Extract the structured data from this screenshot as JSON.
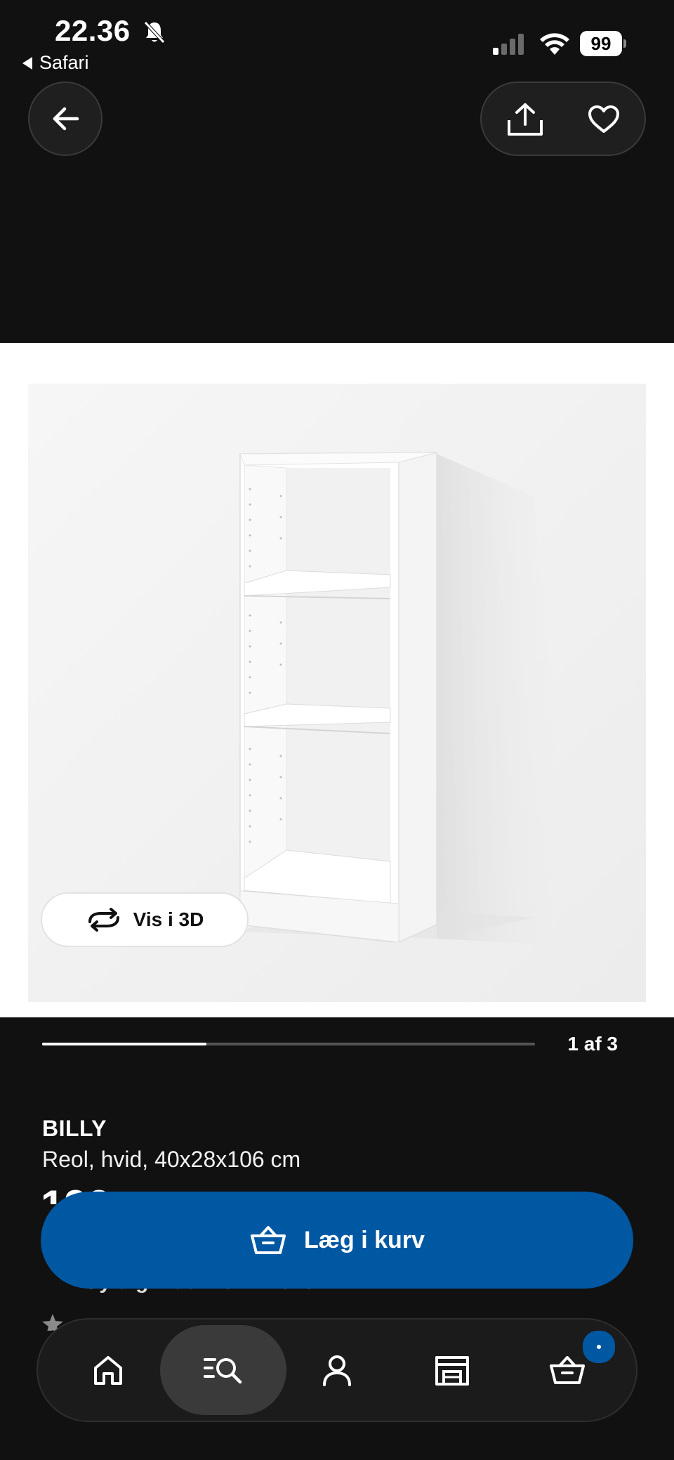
{
  "status_bar": {
    "time": "22.36",
    "back_app": "Safari",
    "battery": "99"
  },
  "header": {
    "back_icon": "arrow-left-icon",
    "share_icon": "share-icon",
    "favorite_icon": "heart-icon"
  },
  "gallery": {
    "view_3d_label": "Vis i 3D",
    "counter": "1 af 3",
    "current_image": 1,
    "total_images": 3
  },
  "product": {
    "name": "BILLY",
    "description": "Reol, hvid, 40x28x106 cm",
    "price_partial": "199",
    "validity_partial": "Gyldig indtil 29.11.2025"
  },
  "cta": {
    "add_to_cart_label": "Læg i kurv",
    "color": "#0058a3"
  },
  "bottom_nav": {
    "items": [
      {
        "icon": "home-icon",
        "active": false
      },
      {
        "icon": "search-icon",
        "active": true
      },
      {
        "icon": "profile-icon",
        "active": false
      },
      {
        "icon": "store-icon",
        "active": false
      },
      {
        "icon": "cart-icon",
        "active": false
      }
    ],
    "cart_badge": true
  }
}
